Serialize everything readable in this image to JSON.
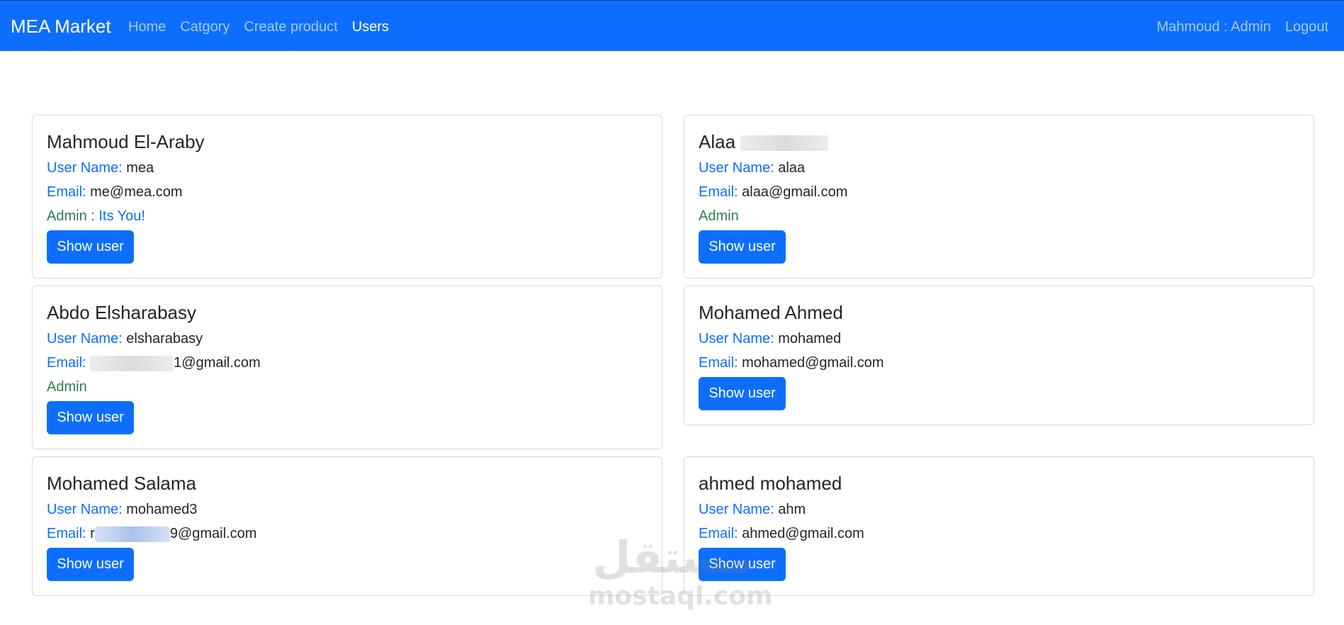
{
  "navbar": {
    "brand": "MEA Market",
    "links": [
      "Home",
      "Catgory",
      "Create product",
      "Users"
    ],
    "user": "Mahmoud : Admin",
    "logout": "Logout"
  },
  "users": [
    {
      "name": "Mahmoud El-Araby",
      "username_label": "User Name:",
      "username": "mea",
      "email_label": "Email:",
      "email": "me@mea.com",
      "admin": "Admin : ",
      "admin_note": "Its You!",
      "button": "Show user"
    },
    {
      "name": "Alaa",
      "username_label": "User Name:",
      "username": "alaa",
      "email_label": "Email:",
      "email": "alaa@gmail.com",
      "admin": "Admin",
      "button": "Show user"
    },
    {
      "name": "Abdo Elsharabasy",
      "username_label": "User Name:",
      "username": "elsharabasy",
      "email_label": "Email:",
      "email": "1@gmail.com",
      "admin": "Admin",
      "button": "Show user"
    },
    {
      "name": "Mohamed Ahmed",
      "username_label": "User Name:",
      "username": "mohamed",
      "email_label": "Email:",
      "email": "mohamed@gmail.com",
      "button": "Show user"
    },
    {
      "name": "Mohamed Salama",
      "username_label": "User Name:",
      "username": "mohamed3",
      "email_label": "Email:",
      "email_prefix": "r",
      "email": "9@gmail.com",
      "button": "Show user"
    },
    {
      "name": "ahmed mohamed",
      "username_label": "User Name:",
      "username": "ahm",
      "email_label": "Email:",
      "email": "ahmed@gmail.com",
      "button": "Show user"
    }
  ],
  "watermark": {
    "arabic": "مستقل",
    "latin": "mostaql.com"
  }
}
